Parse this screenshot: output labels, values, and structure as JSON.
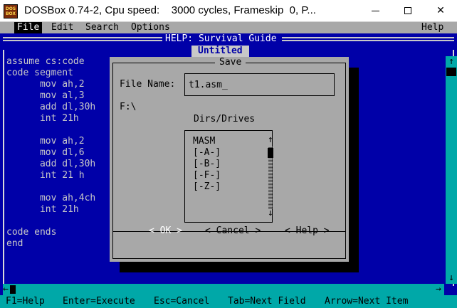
{
  "window": {
    "icon_text": "DOS BOX",
    "title": "DOSBox 0.74-2, Cpu speed:    3000 cycles, Frameskip  0, P..."
  },
  "menu": {
    "file": "File",
    "edit": "Edit",
    "search": "Search",
    "options": "Options",
    "help": "Help"
  },
  "help_line": {
    "title": "HELP: Survival Guide"
  },
  "editor": {
    "title": "Untitled",
    "code_lines": [
      "assume cs:code",
      "code segment",
      "      mov ah,2",
      "      mov al,3",
      "      add dl,30h",
      "      int 21h",
      "",
      "      mov ah,2",
      "      mov dl,6",
      "      add dl,30h",
      "      int 21 h",
      "",
      "      mov ah,4ch",
      "      int 21h",
      "",
      "code ends",
      "end"
    ]
  },
  "scrollbar": {
    "up_arrow": "↑",
    "down_arrow": "↓",
    "left_arrow": "←",
    "right_arrow": "→"
  },
  "dialog": {
    "title": "Save",
    "filename_label": "File Name:",
    "filename_value": "t1.asm_",
    "current_path": "F:\\",
    "dirs_label": "Dirs/Drives",
    "dirs": [
      "MASM",
      "[-A-]",
      "[-B-]",
      "[-F-]",
      "[-Z-]"
    ],
    "ok_label": "< OK >",
    "cancel_label": "< Cancel >",
    "help_label": "< Help >"
  },
  "status_bar": {
    "f1": "F1=Help",
    "enter": "Enter=Execute",
    "esc": "Esc=Cancel",
    "tab": "Tab=Next Field",
    "arrow": "Arrow=Next Item"
  },
  "colors": {
    "dos_blue": "#0000a8",
    "dos_gray": "#a8a8a8",
    "dos_cyan": "#00a8a8",
    "dos_text": "#c8c8c8"
  }
}
